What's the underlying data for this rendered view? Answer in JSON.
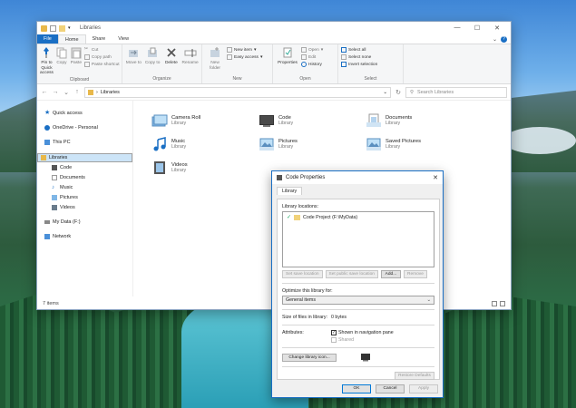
{
  "window": {
    "title": "Libraries"
  },
  "tabs": {
    "file": "File",
    "home": "Home",
    "share": "Share",
    "view": "View"
  },
  "ribbon": {
    "pin": "Pin to Quick access",
    "copy": "Copy",
    "paste": "Paste",
    "cut": "Cut",
    "copy_path": "Copy path",
    "paste_shortcut": "Paste shortcut",
    "clipboard": "Clipboard",
    "move_to": "Move to",
    "copy_to": "Copy to",
    "delete": "Delete",
    "rename": "Rename",
    "organize": "Organize",
    "new_folder": "New folder",
    "new_item": "New item",
    "easy_access": "Easy access",
    "new": "New",
    "properties": "Properties",
    "open": "Open",
    "edit": "Edit",
    "history": "History",
    "open_group": "Open",
    "select_all": "Select all",
    "select_none": "Select none",
    "invert_selection": "Invert selection",
    "select": "Select"
  },
  "address": {
    "path": "Libraries",
    "search_placeholder": "Search Libraries"
  },
  "nav": {
    "quick_access": "Quick access",
    "onedrive": "OneDrive - Personal",
    "this_pc": "This PC",
    "libraries": "Libraries",
    "code": "Code",
    "documents": "Documents",
    "music": "Music",
    "pictures": "Pictures",
    "videos": "Videos",
    "my_data": "My Data (F:)",
    "network": "Network"
  },
  "libraries": [
    {
      "name": "Camera Roll",
      "type": "Library"
    },
    {
      "name": "Code",
      "type": "Library"
    },
    {
      "name": "Documents",
      "type": "Library"
    },
    {
      "name": "Music",
      "type": "Library"
    },
    {
      "name": "Pictures",
      "type": "Library"
    },
    {
      "name": "Saved Pictures",
      "type": "Library"
    },
    {
      "name": "Videos",
      "type": "Library"
    }
  ],
  "status": {
    "items": "7 items"
  },
  "dialog": {
    "title": "Code Properties",
    "tab": "Library",
    "locations_label": "Library locations:",
    "location_item": "Code Project (F:\\MyData)",
    "set_save": "Set save location",
    "set_public": "Set public save location",
    "add": "Add...",
    "remove": "Remove",
    "optimize_label": "Optimize this library for:",
    "optimize_value": "General items",
    "size_label": "Size of files in library:",
    "size_value": "0 bytes",
    "attributes_label": "Attributes:",
    "shown_nav": "Shown in navigation pane",
    "shared": "Shared",
    "change_icon": "Change library icon...",
    "restore": "Restore Defaults",
    "ok": "OK",
    "cancel": "Cancel",
    "apply": "Apply"
  },
  "colors": {
    "accent": "#1a6fc4",
    "selected": "#cce4f7"
  }
}
